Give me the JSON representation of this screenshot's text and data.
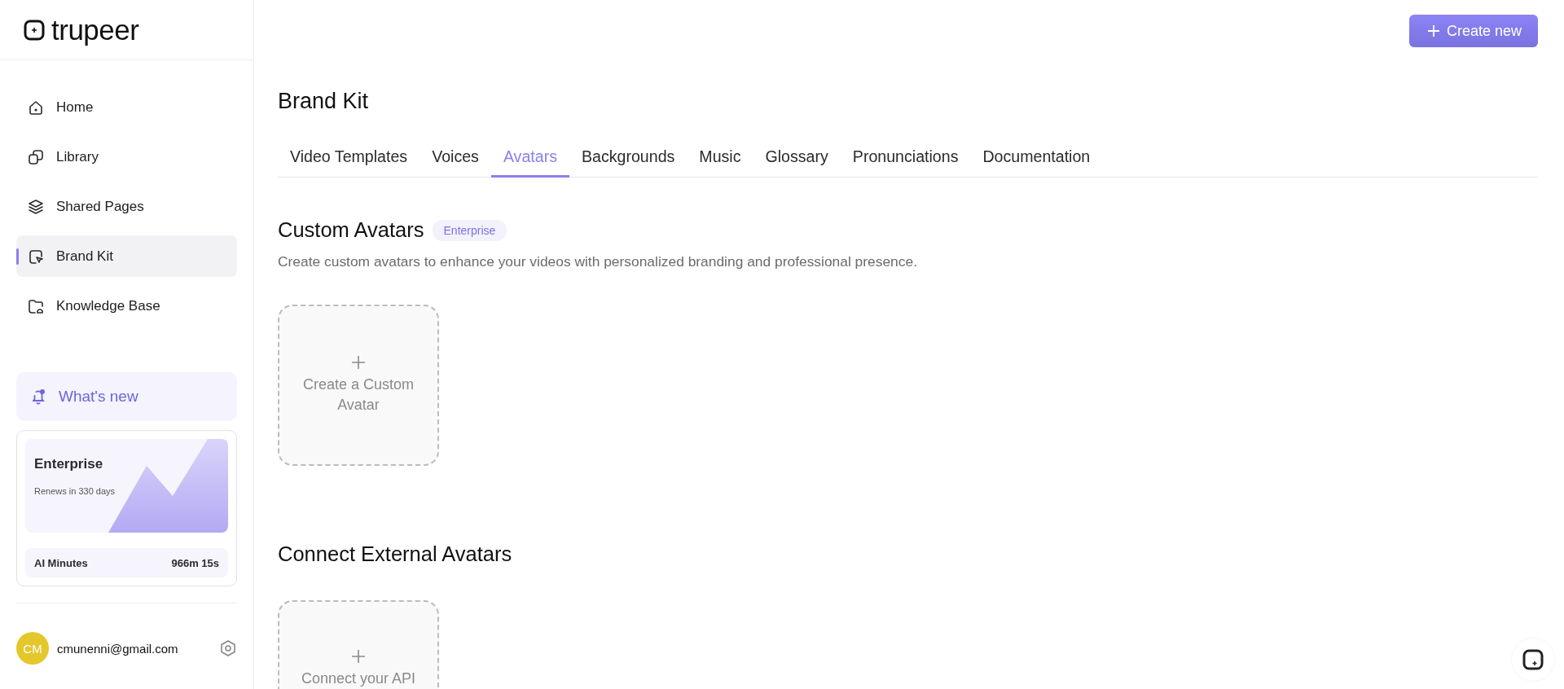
{
  "logo": {
    "text": "trupeer"
  },
  "sidebar": {
    "items": [
      {
        "label": "Home",
        "selected": false
      },
      {
        "label": "Library",
        "selected": false
      },
      {
        "label": "Shared Pages",
        "selected": false
      },
      {
        "label": "Brand Kit",
        "selected": true
      },
      {
        "label": "Knowledge Base",
        "selected": false
      }
    ]
  },
  "whats_new": {
    "label": "What's new"
  },
  "plan": {
    "name": "Enterprise",
    "renewal": "Renews in 330 days",
    "usage_label": "AI Minutes",
    "usage_value": "966m 15s"
  },
  "user": {
    "initials": "CM",
    "email": "cmunenni@gmail.com"
  },
  "header": {
    "create_button": "Create new"
  },
  "page": {
    "title": "Brand Kit",
    "tabs": [
      {
        "label": "Video Templates",
        "selected": false
      },
      {
        "label": "Voices",
        "selected": false
      },
      {
        "label": "Avatars",
        "selected": true
      },
      {
        "label": "Backgrounds",
        "selected": false
      },
      {
        "label": "Music",
        "selected": false
      },
      {
        "label": "Glossary",
        "selected": false
      },
      {
        "label": "Pronunciations",
        "selected": false
      },
      {
        "label": "Documentation",
        "selected": false
      }
    ],
    "sections": [
      {
        "title": "Custom Avatars",
        "badge": "Enterprise",
        "description": "Create custom avatars to enhance your videos with personalized branding and professional presence.",
        "card": "Create a Custom Avatar"
      },
      {
        "title": "Connect External Avatars",
        "card": "Connect your API"
      }
    ]
  }
}
